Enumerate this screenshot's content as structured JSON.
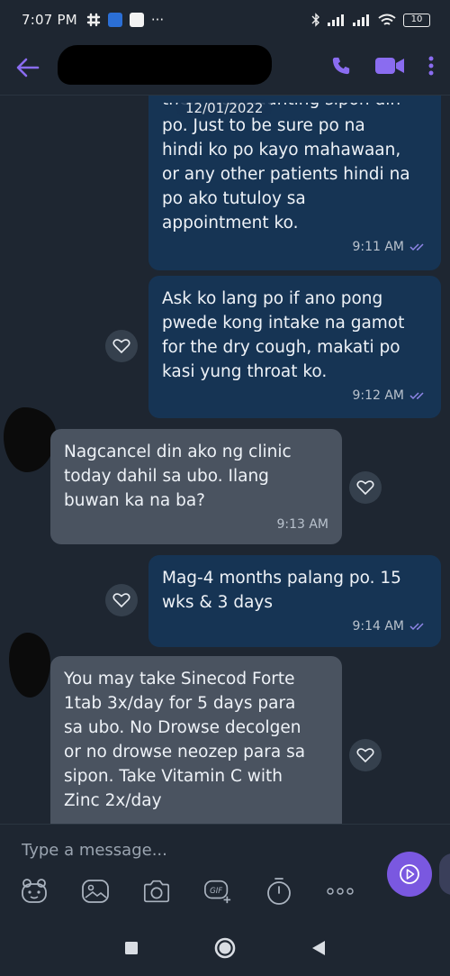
{
  "status_bar": {
    "time": "7:07 PM",
    "more": "···",
    "battery": "10"
  },
  "header": {
    "contact_name": "",
    "back_icon": "arrow-left-icon",
    "call_icon": "phone-icon",
    "video_icon": "video-camera-icon",
    "menu_icon": "more-vertical-icon"
  },
  "chat": {
    "date_chip": "12/01/2022",
    "partial_text": "then may kaunting sipon din",
    "messages": [
      {
        "direction": "outgoing",
        "text_lines": [
          "po. Just to be sure po na",
          "hindi ko po kayo mahawaan,",
          "or any other patients hindi na",
          "po ako tutuloy sa",
          "appointment ko."
        ],
        "time": "9:11 AM",
        "status": "read"
      },
      {
        "direction": "outgoing",
        "text_lines": [
          "Ask ko lang po if ano pong",
          "pwede kong intake na gamot",
          "for the dry cough, makati po",
          "kasi yung throat ko."
        ],
        "time": "9:12 AM",
        "status": "read"
      },
      {
        "direction": "incoming",
        "text_lines": [
          "Nagcancel din ako ng clinic",
          "today dahil sa ubo. Ilang",
          "buwan ka na ba?"
        ],
        "time": "9:13 AM"
      },
      {
        "direction": "outgoing",
        "text_lines": [
          "Mag-4 months palang po. 15",
          "wks & 3 days"
        ],
        "time": "9:14 AM",
        "status": "read"
      },
      {
        "direction": "incoming",
        "text_lines": [
          "You may take Sinecod Forte",
          "1tab 3x/day for 5 days para",
          "sa ubo. No Drowse decolgen",
          "or no drowse neozep para sa",
          "sipon. Take Vitamin C with",
          "Zinc 2x/day"
        ],
        "time": ""
      }
    ]
  },
  "composer": {
    "placeholder": "Type a message...",
    "tools": [
      "sticker-icon",
      "gallery-icon",
      "camera-icon",
      "gif-icon",
      "timer-icon",
      "more-horizontal-icon"
    ],
    "send_icon": "send-icon"
  },
  "colors": {
    "background": "#1e2631",
    "outgoing_bubble": "#163454",
    "incoming_bubble": "#4a5360",
    "accent": "#7a58e0",
    "read_check": "#8f86e8"
  }
}
